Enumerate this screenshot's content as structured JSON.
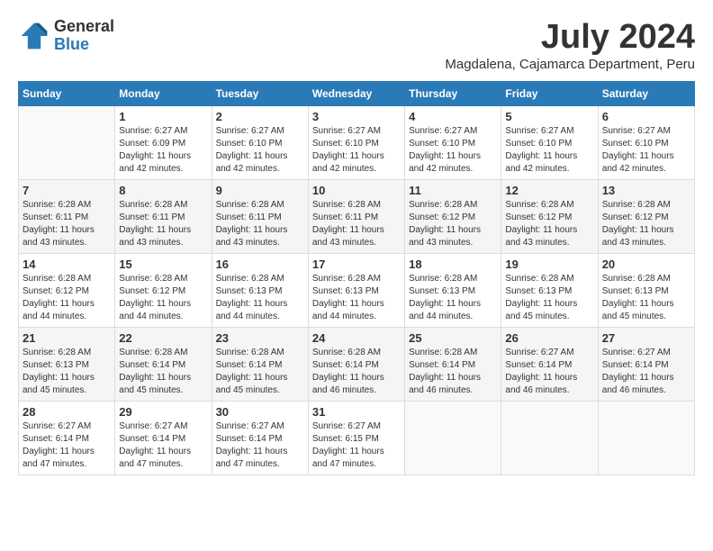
{
  "header": {
    "logo_general": "General",
    "logo_blue": "Blue",
    "month_year": "July 2024",
    "location": "Magdalena, Cajamarca Department, Peru"
  },
  "days_of_week": [
    "Sunday",
    "Monday",
    "Tuesday",
    "Wednesday",
    "Thursday",
    "Friday",
    "Saturday"
  ],
  "weeks": [
    [
      {
        "day": "",
        "info": ""
      },
      {
        "day": "1",
        "info": "Sunrise: 6:27 AM\nSunset: 6:09 PM\nDaylight: 11 hours\nand 42 minutes."
      },
      {
        "day": "2",
        "info": "Sunrise: 6:27 AM\nSunset: 6:10 PM\nDaylight: 11 hours\nand 42 minutes."
      },
      {
        "day": "3",
        "info": "Sunrise: 6:27 AM\nSunset: 6:10 PM\nDaylight: 11 hours\nand 42 minutes."
      },
      {
        "day": "4",
        "info": "Sunrise: 6:27 AM\nSunset: 6:10 PM\nDaylight: 11 hours\nand 42 minutes."
      },
      {
        "day": "5",
        "info": "Sunrise: 6:27 AM\nSunset: 6:10 PM\nDaylight: 11 hours\nand 42 minutes."
      },
      {
        "day": "6",
        "info": "Sunrise: 6:27 AM\nSunset: 6:10 PM\nDaylight: 11 hours\nand 42 minutes."
      }
    ],
    [
      {
        "day": "7",
        "info": "Sunrise: 6:28 AM\nSunset: 6:11 PM\nDaylight: 11 hours\nand 43 minutes."
      },
      {
        "day": "8",
        "info": "Sunrise: 6:28 AM\nSunset: 6:11 PM\nDaylight: 11 hours\nand 43 minutes."
      },
      {
        "day": "9",
        "info": "Sunrise: 6:28 AM\nSunset: 6:11 PM\nDaylight: 11 hours\nand 43 minutes."
      },
      {
        "day": "10",
        "info": "Sunrise: 6:28 AM\nSunset: 6:11 PM\nDaylight: 11 hours\nand 43 minutes."
      },
      {
        "day": "11",
        "info": "Sunrise: 6:28 AM\nSunset: 6:12 PM\nDaylight: 11 hours\nand 43 minutes."
      },
      {
        "day": "12",
        "info": "Sunrise: 6:28 AM\nSunset: 6:12 PM\nDaylight: 11 hours\nand 43 minutes."
      },
      {
        "day": "13",
        "info": "Sunrise: 6:28 AM\nSunset: 6:12 PM\nDaylight: 11 hours\nand 43 minutes."
      }
    ],
    [
      {
        "day": "14",
        "info": "Sunrise: 6:28 AM\nSunset: 6:12 PM\nDaylight: 11 hours\nand 44 minutes."
      },
      {
        "day": "15",
        "info": "Sunrise: 6:28 AM\nSunset: 6:12 PM\nDaylight: 11 hours\nand 44 minutes."
      },
      {
        "day": "16",
        "info": "Sunrise: 6:28 AM\nSunset: 6:13 PM\nDaylight: 11 hours\nand 44 minutes."
      },
      {
        "day": "17",
        "info": "Sunrise: 6:28 AM\nSunset: 6:13 PM\nDaylight: 11 hours\nand 44 minutes."
      },
      {
        "day": "18",
        "info": "Sunrise: 6:28 AM\nSunset: 6:13 PM\nDaylight: 11 hours\nand 44 minutes."
      },
      {
        "day": "19",
        "info": "Sunrise: 6:28 AM\nSunset: 6:13 PM\nDaylight: 11 hours\nand 45 minutes."
      },
      {
        "day": "20",
        "info": "Sunrise: 6:28 AM\nSunset: 6:13 PM\nDaylight: 11 hours\nand 45 minutes."
      }
    ],
    [
      {
        "day": "21",
        "info": "Sunrise: 6:28 AM\nSunset: 6:13 PM\nDaylight: 11 hours\nand 45 minutes."
      },
      {
        "day": "22",
        "info": "Sunrise: 6:28 AM\nSunset: 6:14 PM\nDaylight: 11 hours\nand 45 minutes."
      },
      {
        "day": "23",
        "info": "Sunrise: 6:28 AM\nSunset: 6:14 PM\nDaylight: 11 hours\nand 45 minutes."
      },
      {
        "day": "24",
        "info": "Sunrise: 6:28 AM\nSunset: 6:14 PM\nDaylight: 11 hours\nand 46 minutes."
      },
      {
        "day": "25",
        "info": "Sunrise: 6:28 AM\nSunset: 6:14 PM\nDaylight: 11 hours\nand 46 minutes."
      },
      {
        "day": "26",
        "info": "Sunrise: 6:27 AM\nSunset: 6:14 PM\nDaylight: 11 hours\nand 46 minutes."
      },
      {
        "day": "27",
        "info": "Sunrise: 6:27 AM\nSunset: 6:14 PM\nDaylight: 11 hours\nand 46 minutes."
      }
    ],
    [
      {
        "day": "28",
        "info": "Sunrise: 6:27 AM\nSunset: 6:14 PM\nDaylight: 11 hours\nand 47 minutes."
      },
      {
        "day": "29",
        "info": "Sunrise: 6:27 AM\nSunset: 6:14 PM\nDaylight: 11 hours\nand 47 minutes."
      },
      {
        "day": "30",
        "info": "Sunrise: 6:27 AM\nSunset: 6:14 PM\nDaylight: 11 hours\nand 47 minutes."
      },
      {
        "day": "31",
        "info": "Sunrise: 6:27 AM\nSunset: 6:15 PM\nDaylight: 11 hours\nand 47 minutes."
      },
      {
        "day": "",
        "info": ""
      },
      {
        "day": "",
        "info": ""
      },
      {
        "day": "",
        "info": ""
      }
    ]
  ]
}
